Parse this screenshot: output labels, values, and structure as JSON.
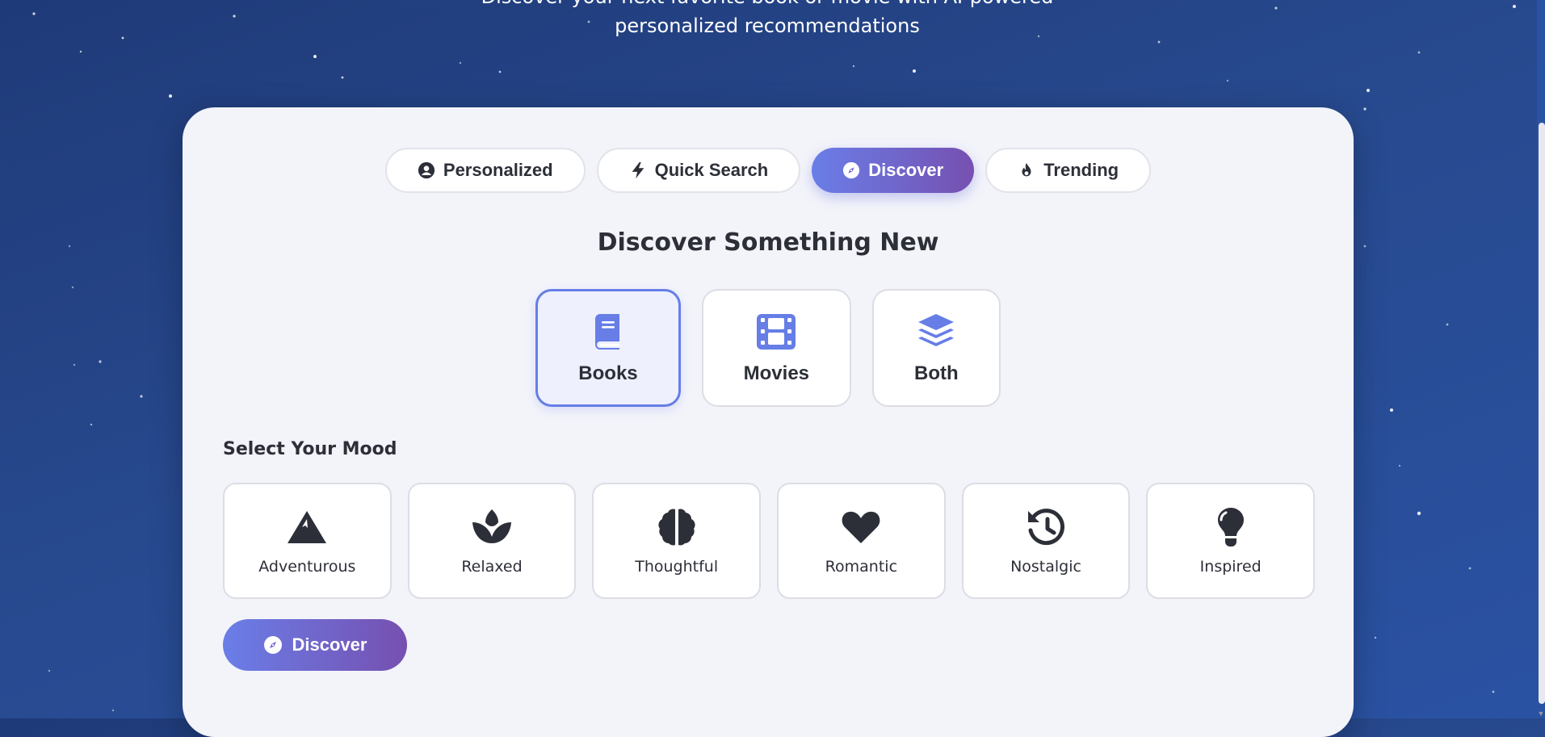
{
  "hero": {
    "subtitle_line1": "Discover your next favorite book or movie with AI-powered",
    "subtitle_line2": "personalized recommendations"
  },
  "tabs": [
    {
      "label": "Personalized",
      "icon": "user-circle-icon",
      "active": false
    },
    {
      "label": "Quick Search",
      "icon": "bolt-icon",
      "active": false
    },
    {
      "label": "Discover",
      "icon": "compass-icon",
      "active": true
    },
    {
      "label": "Trending",
      "icon": "fire-icon",
      "active": false
    }
  ],
  "discover": {
    "heading": "Discover Something New",
    "types": [
      {
        "label": "Books",
        "icon": "book-icon",
        "selected": true
      },
      {
        "label": "Movies",
        "icon": "film-icon",
        "selected": false
      },
      {
        "label": "Both",
        "icon": "layers-icon",
        "selected": false
      }
    ],
    "mood_title": "Select Your Mood",
    "moods": [
      {
        "label": "Adventurous",
        "icon": "mountain-icon"
      },
      {
        "label": "Relaxed",
        "icon": "lotus-icon"
      },
      {
        "label": "Thoughtful",
        "icon": "brain-icon"
      },
      {
        "label": "Romantic",
        "icon": "heart-icon"
      },
      {
        "label": "Nostalgic",
        "icon": "history-icon"
      },
      {
        "label": "Inspired",
        "icon": "lightbulb-icon"
      }
    ],
    "button_label": "Discover",
    "button_icon": "compass-icon"
  },
  "colors": {
    "accent_start": "#6a7ee8",
    "accent_end": "#7650b0",
    "page_bg": "#27498e",
    "card_bg": "#f3f4fa",
    "text_dark": "#2d2f38",
    "icon_blue": "#667ee6"
  }
}
